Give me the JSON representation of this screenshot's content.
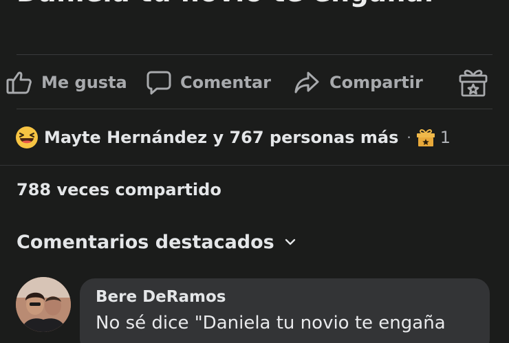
{
  "post": {
    "text": "Daniela tu novio te engaña."
  },
  "actions": {
    "like_label": "Me gusta",
    "comment_label": "Comentar",
    "share_label": "Compartir",
    "like_icon": "thumbs-up-icon",
    "comment_icon": "speech-bubble-icon",
    "share_icon": "share-arrow-icon",
    "gift_icon": "gift-icon"
  },
  "reactions": {
    "emoji": "laughing-emoji-icon",
    "summary": "Mayte Hernández y 767 personas más",
    "separator": "·",
    "gift_count": "1"
  },
  "shares": {
    "text": "788 veces compartido"
  },
  "comments_section": {
    "title": "Comentarios destacados"
  },
  "comment": {
    "author": "Bere DeRamos",
    "text": "No sé dice \"Daniela tu novio te engaña"
  },
  "colors": {
    "background": "#1b1c1b",
    "bubble": "#333436",
    "muted_text": "#a8aaad",
    "primary_text": "#e4e6e8",
    "emoji_yellow": "#f7c443",
    "gift_gold": "#e8a93a"
  }
}
